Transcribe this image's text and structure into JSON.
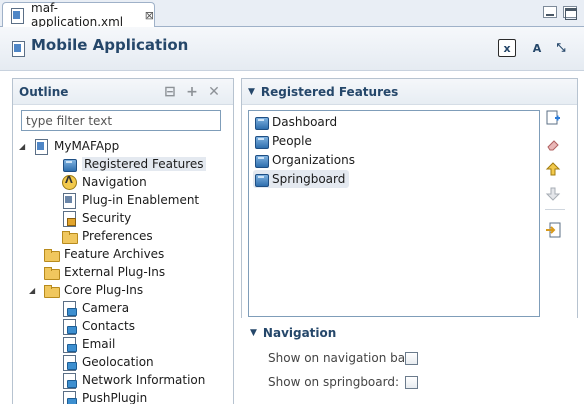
{
  "tab": {
    "label": "maf-application.xml",
    "close_glyph": "⊠"
  },
  "header": {
    "title": "Mobile Application",
    "button_xml_label": "x",
    "button_a_label": "A",
    "button_pin_label": "⤡"
  },
  "outline": {
    "title": "Outline",
    "filter_placeholder": "type filter text",
    "tree": [
      {
        "label": "MyMAFApp",
        "icon": "app-file-icon",
        "expanded": true
      },
      {
        "label": "Registered Features",
        "icon": "cube-icon",
        "selected": true
      },
      {
        "label": "Navigation",
        "icon": "nav-icon"
      },
      {
        "label": "Plug-in Enablement",
        "icon": "page-icon"
      },
      {
        "label": "Security",
        "icon": "lock-page-icon"
      },
      {
        "label": "Preferences",
        "icon": "folder-icon"
      },
      {
        "label": "Feature Archives",
        "icon": "folder-icon"
      },
      {
        "label": "External Plug-Ins",
        "icon": "folder-icon"
      },
      {
        "label": "Core Plug-Ins",
        "icon": "folder-icon",
        "expanded": true
      },
      {
        "label": "Camera",
        "icon": "plug-icon"
      },
      {
        "label": "Contacts",
        "icon": "plug-icon"
      },
      {
        "label": "Email",
        "icon": "plug-icon"
      },
      {
        "label": "Geolocation",
        "icon": "plug-icon"
      },
      {
        "label": "Network Information",
        "icon": "plug-icon"
      },
      {
        "label": "PushPlugin",
        "icon": "plug-icon"
      }
    ]
  },
  "registered_features": {
    "title": "Registered Features",
    "items": [
      {
        "label": "Dashboard",
        "icon": "cube-icon"
      },
      {
        "label": "People",
        "icon": "cube-icon"
      },
      {
        "label": "Organizations",
        "icon": "cube-icon"
      },
      {
        "label": "Springboard",
        "icon": "cube-icon",
        "selected": true
      }
    ],
    "tools": [
      "add-icon",
      "delete-icon",
      "move-up-icon",
      "move-down-icon",
      "insert-icon"
    ]
  },
  "navigation": {
    "title": "Navigation",
    "show_nav_bar_label": "Show on navigation bar:",
    "show_nav_bar_checked": false,
    "show_springboard_label": "Show on springboard:",
    "show_springboard_checked": false
  },
  "colors": {
    "accent": "#25476a",
    "selection": "#e4e9f0",
    "panel_border": "#b7c3d0"
  }
}
